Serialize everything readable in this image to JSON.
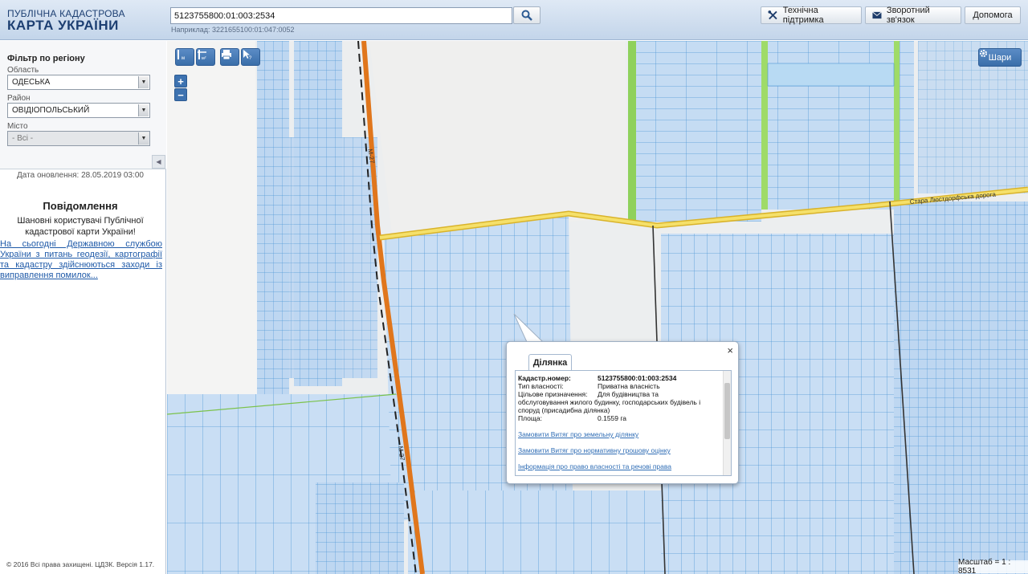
{
  "header": {
    "logo_line1": "ПУБЛІЧНА КАДАСТРОВА",
    "logo_line2": "КАРТА УКРАЇНИ",
    "search_value": "5123755800:01:003:2534",
    "search_hint": "Наприклад: 3221655100:01:047:0052",
    "support_label": "Технічна підтримка",
    "feedback_label": "Зворотний зв'язок",
    "help_label": "Допомога"
  },
  "sidebar": {
    "filter_title": "Фільтр по регіону",
    "region_label": "Область",
    "region_value": "ОДЕСЬКА",
    "district_label": "Район",
    "district_value": "ОВІДІОПОЛЬСЬКИЙ",
    "city_label": "Місто",
    "city_value": "- Всі -",
    "update_date": "Дата оновлення: 28.05.2019 03:00",
    "notice_title": "Повідомлення",
    "notice_subtitle": "Шановні користувачі Публічної кадастрової карти України!",
    "notice_link": "На сьогодні Державною службою України з питань геодезії, картографії та кадастру здійснюються заходи із виправлення помилок...",
    "copyright": "© 2016 Всі права захищені. ЦДЗК. Версія 1.17."
  },
  "map": {
    "layers_label": "Шари",
    "scale_text": "Масштаб = 1 : 8531",
    "road_label_1": "М-27",
    "road_label_2": "М-27",
    "road_label_3": "Стара Люстдорфська дорога"
  },
  "popup": {
    "tab_label": "Ділянка",
    "cadastr_label": "Кадастр.номер:",
    "cadastr_value": "5123755800:01:003:2534",
    "ownership_label": "Тип власності:",
    "ownership_value": "Приватна власність",
    "purpose_label": "Цільове призначення:",
    "purpose_value_1": "Для будівництва та",
    "purpose_value_2": "обслуговування жилого будинку, господарських будівель і",
    "purpose_value_3": "споруд (присадибна ділянка)",
    "area_label": "Площа:",
    "area_value": "0.1559 га",
    "link1": "Замовити Витяг про земельну ділянку",
    "link2": "Замовити Витяг про нормативну грошову оцінку",
    "link3": "Інформація про право власності та речові права",
    "close_label": "×"
  },
  "colors": {
    "parcel_fill": "#c9def4",
    "parcel_stroke": "#4f97d6",
    "road_orange": "#e0761c",
    "road_yellow": "#f0d23c",
    "green_strip": "#8fd15c"
  }
}
